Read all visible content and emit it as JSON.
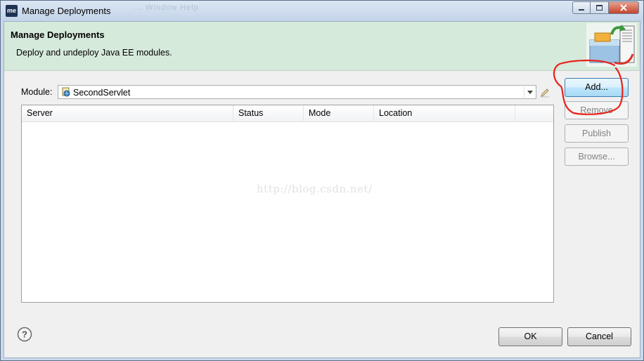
{
  "window": {
    "title": "Manage Deployments",
    "app_icon_text": "me",
    "ghost_menu": "…    Window    Help"
  },
  "header": {
    "title": "Manage Deployments",
    "description": "Deploy and undeploy Java EE modules."
  },
  "module": {
    "label": "Module:",
    "selected": "SecondServlet"
  },
  "table": {
    "columns": [
      "Server",
      "Status",
      "Mode",
      "Location"
    ],
    "rows": []
  },
  "watermark": "http://blog.csdn.net/",
  "side_buttons": {
    "add": "Add...",
    "remove": "Remove",
    "publish": "Publish",
    "browse": "Browse..."
  },
  "footer": {
    "ok": "OK",
    "cancel": "Cancel"
  },
  "colors": {
    "header_bg": "#d6eadb",
    "annotation": "#e8231b",
    "default_button": "#3c7fb1"
  },
  "icons": {
    "app": "me-icon",
    "module": "web-project-icon",
    "edit": "pencil-icon",
    "help": "question-icon",
    "banner": "server-deploy-icon"
  }
}
